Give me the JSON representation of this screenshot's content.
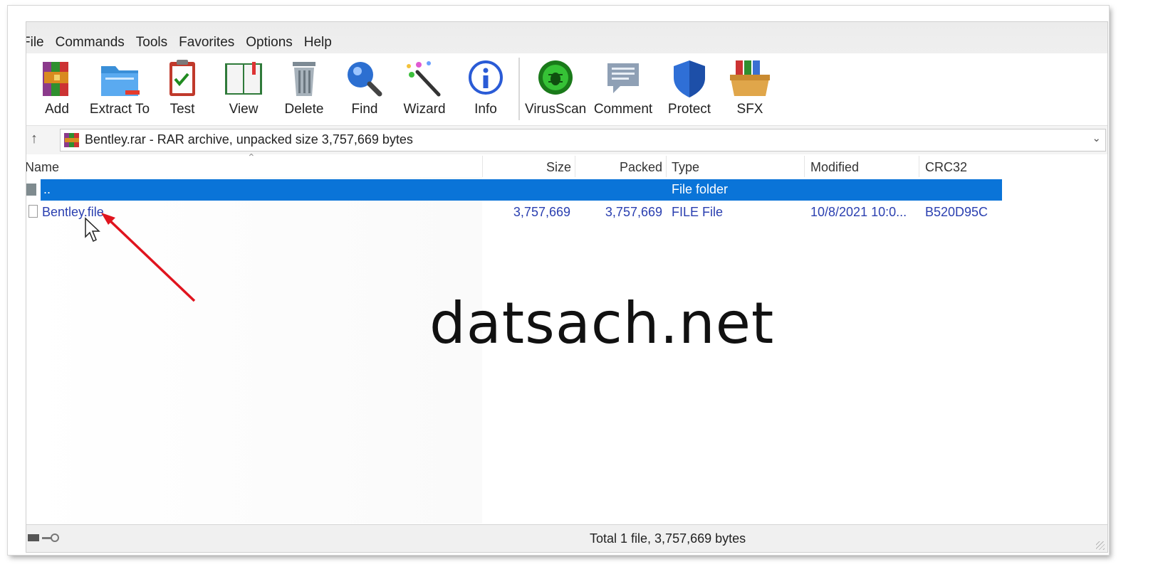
{
  "menu": [
    "File",
    "Commands",
    "Tools",
    "Favorites",
    "Options",
    "Help"
  ],
  "toolbar": {
    "add": "Add",
    "extract_to": "Extract To",
    "test": "Test",
    "view": "View",
    "delete": "Delete",
    "find": "Find",
    "wizard": "Wizard",
    "info": "Info",
    "virusscan": "VirusScan",
    "comment": "Comment",
    "protect": "Protect",
    "sfx": "SFX"
  },
  "address": {
    "text": "Bentley.rar - RAR archive, unpacked size 3,757,669 bytes",
    "up_icon": "up-arrow-icon",
    "dropdown_icon": "chevron-down-icon"
  },
  "columns": {
    "name": "Name",
    "size": "Size",
    "packed": "Packed",
    "type": "Type",
    "modified": "Modified",
    "crc32": "CRC32"
  },
  "rows": [
    {
      "name": "..",
      "size": "",
      "packed": "",
      "type": "File folder",
      "modified": "",
      "crc32": ""
    },
    {
      "name": "Bentley.file",
      "size": "3,757,669",
      "packed": "3,757,669",
      "type": "FILE File",
      "modified": "10/8/2021 10:0...",
      "crc32": "B520D95C"
    }
  ],
  "status": {
    "text": "Total 1 file, 3,757,669 bytes"
  },
  "watermark": "datsach.net",
  "colors": {
    "selection": "#0a74d8",
    "link_text": "#2a3fb0",
    "annotation_arrow": "#e0141e"
  }
}
